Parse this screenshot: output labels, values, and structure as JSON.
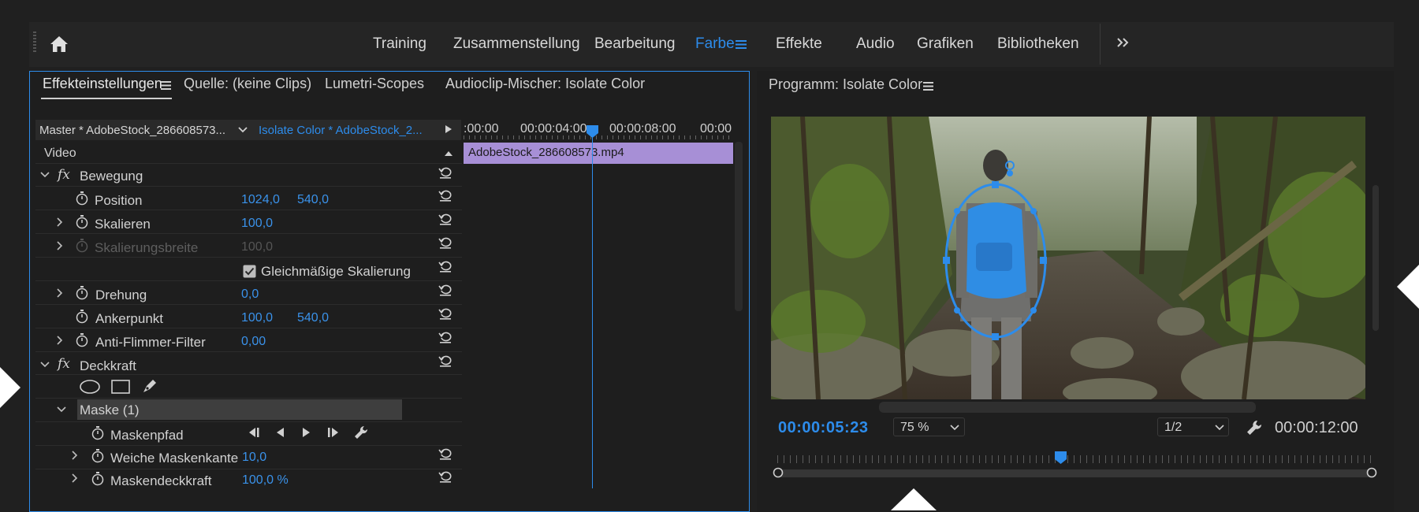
{
  "workspaces": [
    "Training",
    "Zusammenstellung",
    "Bearbeitung",
    "Farbe",
    "Effekte",
    "Audio",
    "Grafiken",
    "Bibliotheken"
  ],
  "active_workspace_index": 3,
  "left_tabs": {
    "effects": "Effekteinstellungen",
    "source": "Quelle: (keine Clips)",
    "lumetri": "Lumetri-Scopes",
    "mixer": "Audioclip-Mischer: Isolate Color"
  },
  "effect_controls": {
    "master": "Master * AdobeStock_286608573...",
    "clip": "Isolate Color * AdobeStock_2...",
    "video_label": "Video",
    "motion": "Bewegung",
    "position": {
      "label": "Position",
      "x": "1024,0",
      "y": "540,0"
    },
    "scale": {
      "label": "Skalieren",
      "value": "100,0"
    },
    "scale_width": {
      "label": "Skalierungsbreite",
      "value": "100,0"
    },
    "uniform": "Gleichmäßige Skalierung",
    "rotation": {
      "label": "Drehung",
      "value": "0,0"
    },
    "anchor": {
      "label": "Ankerpunkt",
      "x": "100,0",
      "y": "540,0"
    },
    "flicker": {
      "label": "Anti-Flimmer-Filter",
      "value": "0,00"
    },
    "opacity": "Deckkraft",
    "mask": "Maske (1)",
    "mask_path": "Maskenpfad",
    "feather": {
      "label": "Weiche Maskenkante",
      "value": "10,0"
    },
    "mask_opacity": {
      "label": "Maskendeckkraft",
      "value": "100,0 %"
    }
  },
  "timeline": {
    "t0": ":00:00",
    "t1": "00:00:04:00",
    "t2": "00:00:08:00",
    "t3": "00:00",
    "clip": "AdobeStock_286608573.mp4"
  },
  "program": {
    "title": "Programm: Isolate Color",
    "timecode": "00:00:05:23",
    "zoom": "75 %",
    "resolution": "1/2",
    "duration": "00:00:12:00"
  },
  "colors": {
    "accent": "#2d8ceb",
    "clip": "#a78fd6",
    "bg": "#1e1e1e"
  }
}
